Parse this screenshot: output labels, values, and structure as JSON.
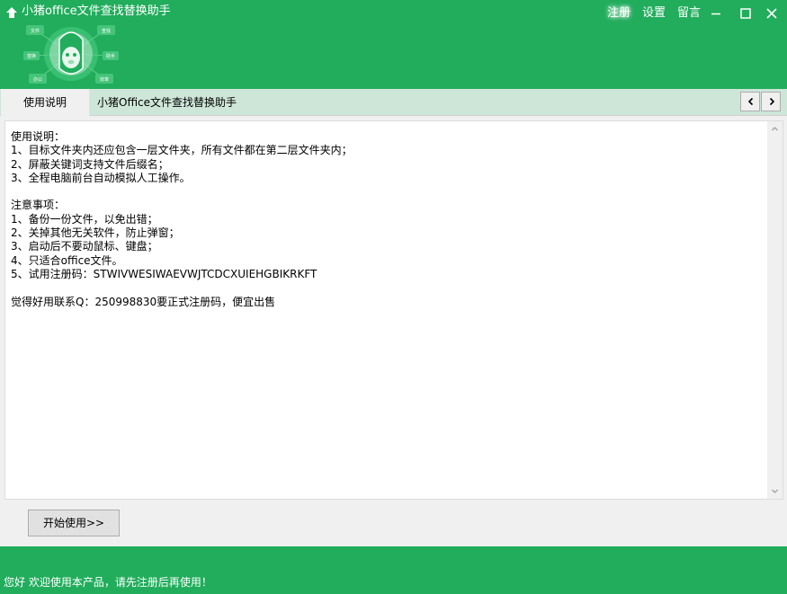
{
  "window": {
    "title": "小猪office文件查找替换助手",
    "top_links": {
      "register": "注册",
      "settings": "设置",
      "message": "留言"
    },
    "accent_color": "#21ad5c"
  },
  "logo": {
    "icon": "pig-mascot-logo",
    "bubbles": [
      "文件",
      "查找",
      "替换",
      "助手",
      "办公",
      "效率"
    ]
  },
  "tabs": {
    "active": "使用说明",
    "inactive": "小猪Office文件查找替换助手"
  },
  "instructions": {
    "lines": [
      "使用说明：",
      "1、目标文件夹内还应包含一层文件夹，所有文件都在第二层文件夹内；",
      "2、屏蔽关键词支持文件后缀名；",
      "3、全程电脑前台自动模拟人工操作。",
      "",
      "注意事项：",
      "1、备份一份文件，以免出错；",
      "2、关掉其他无关软件，防止弹窗；",
      "3、启动后不要动鼠标、键盘；",
      "4、只适合office文件。",
      "5、试用注册码：STWIVWESIWAEVWJTCDCXUIEHGBIKRKFT",
      "",
      "觉得好用联系Q：250998830要正式注册码，便宜出售"
    ]
  },
  "start_button": "开始使用>>",
  "status": "您好 欢迎使用本产品，请先注册后再使用！"
}
